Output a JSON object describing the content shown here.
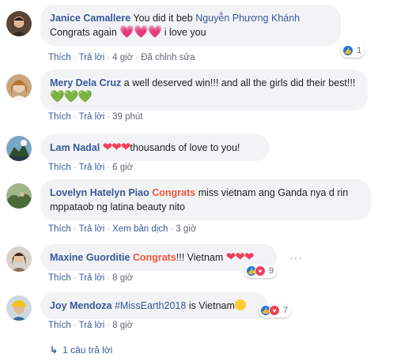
{
  "comments": [
    {
      "author": "Janice Camallere",
      "text_a": " You did it beb ",
      "mention": "Nguyễn Phương Khánh",
      "text_b": " Congrats again ",
      "hearts": "💗💗💗",
      "text_c": " i love you",
      "actions": {
        "like": "Thích",
        "reply": "Trả lời",
        "time": "4 giờ",
        "edit": "Đã chỉnh sửa"
      },
      "reaction_count": "1"
    },
    {
      "author": "Mery Dela Cruz",
      "text_a": " a well deserved win!!! and all the girls did their best!!! ",
      "hearts": "💚💚💚",
      "actions": {
        "like": "Thích",
        "reply": "Trả lời",
        "time": "39 phút"
      }
    },
    {
      "author": "Lam Nadal",
      "hearts": "❤❤❤",
      "text_a": "thousands of love to you!",
      "actions": {
        "like": "Thích",
        "reply": "Trả lời",
        "time": "6 giờ"
      }
    },
    {
      "author": "Lovelyn Hatelyn Piao",
      "highlight": "Congrats",
      "text_a": " miss vietnam ang Ganda nya d rin mppataob ng latina beauty nito",
      "actions": {
        "like": "Thích",
        "reply": "Trả lời",
        "translate": "Xem bản dịch",
        "time": "3 giờ"
      }
    },
    {
      "author": "Maxine Guorditie",
      "highlight": "Congrats",
      "text_a": "!!! Vietnam ",
      "hearts": "❤❤❤",
      "actions": {
        "like": "Thích",
        "reply": "Trả lời",
        "time": "8 giờ"
      },
      "reaction_count": "9",
      "more": "···"
    },
    {
      "author": "Joy Mendoza",
      "hashtag": "#MissEarth2018",
      "text_a": " is Vietnam",
      "actions": {
        "like": "Thích",
        "reply": "Trả lời",
        "time": "8 giờ"
      },
      "reaction_count": "7"
    }
  ],
  "replies_link": "1 câu trả lời",
  "colors": {
    "link": "#385898",
    "bubble": "#f2f3f5",
    "orange": "#f2553c",
    "heart": "#f33e58",
    "like": "#1877f2"
  },
  "icons": {
    "like": "like-icon",
    "love": "love-icon",
    "reply_arrow": "reply-arrow-icon",
    "more": "more-icon"
  }
}
